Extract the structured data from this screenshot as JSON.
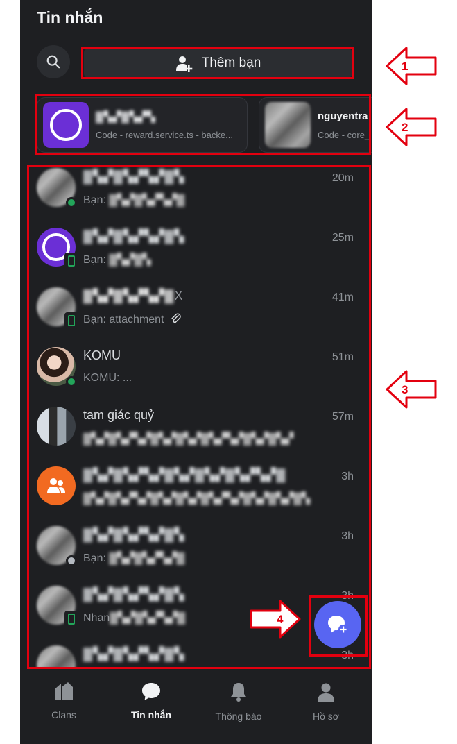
{
  "header": {
    "title": "Tin nhắn"
  },
  "search": {
    "icon": "search-icon"
  },
  "add_friend": {
    "label": "Thêm bạn",
    "icon": "add-user-icon"
  },
  "recent": [
    {
      "name": "▓▚▞▓▚▞▚",
      "subtitle": "Code - reward.service.ts - backe..."
    },
    {
      "name": "nguyentra",
      "subtitle": "Code - core_"
    }
  ],
  "conversations": [
    {
      "name": "▓▚▞▓▚▞▚▞▓▚",
      "prefix": "Bạn: ",
      "message": "▓▚▞▓▚▞▚▞▓",
      "time": "20m",
      "status": "online"
    },
    {
      "name": "▓▚▞▓▚▞▚▞▓▚",
      "prefix": "Bạn: ",
      "message": "▓▚▞▓▚",
      "time": "25m",
      "status": "mobile"
    },
    {
      "name": "▓▚▞▓▚▞▚▞▓",
      "name_suffix": "X",
      "prefix": "Bạn: ",
      "message": "attachment",
      "time": "41m",
      "status": "mobile"
    },
    {
      "name": "KOMU",
      "prefix": "",
      "message": "KOMU: ...",
      "time": "51m",
      "status": "online"
    },
    {
      "name": "tam giác quỷ",
      "prefix": "",
      "message": "▓▚▞▓▚▞▚▞▓▚▞▓▚▞▓▚▞▚▞▓▚▞▓▚▞",
      "time": "57m",
      "status": ""
    },
    {
      "name": "▓▚▞▓▚▞▚▞▓▚▞▓▚▞▓▚▞▚▞▓",
      "prefix": "",
      "message": "▓▚▞▓▚▞▚▞▓▚▞▓▚▞▓▚▞▚▞▓▚▞▓▚▞▓▚",
      "time": "3h",
      "status": ""
    },
    {
      "name": "▓▚▞▓▚▞▚▞▓▚",
      "prefix": "Bạn: ",
      "message": "▓▚▞▓▚▞▚▞▓",
      "time": "3h",
      "status": "idle"
    },
    {
      "name": "▓▚▞▓▚▞▚▞▓▚",
      "prefix": "Nhan",
      "message": "▓▚▞▓▚▞▚▞▓",
      "time": "3h",
      "status": "mobile"
    },
    {
      "name": "▓▚▞▓▚▞▚▞▓▚",
      "prefix": "",
      "message": "",
      "time": "3h",
      "status": ""
    }
  ],
  "nav": [
    {
      "label": "Clans",
      "icon": "clans-icon"
    },
    {
      "label": "Tin nhắn",
      "icon": "chat-icon"
    },
    {
      "label": "Thông báo",
      "icon": "bell-icon"
    },
    {
      "label": "Hồ sơ",
      "icon": "profile-icon"
    }
  ],
  "annotations": [
    "1",
    "2",
    "3",
    "4"
  ],
  "colors": {
    "background": "#1e1f22",
    "accent": "#5865f2",
    "online": "#23a55a",
    "highlight": "#e3000f"
  }
}
